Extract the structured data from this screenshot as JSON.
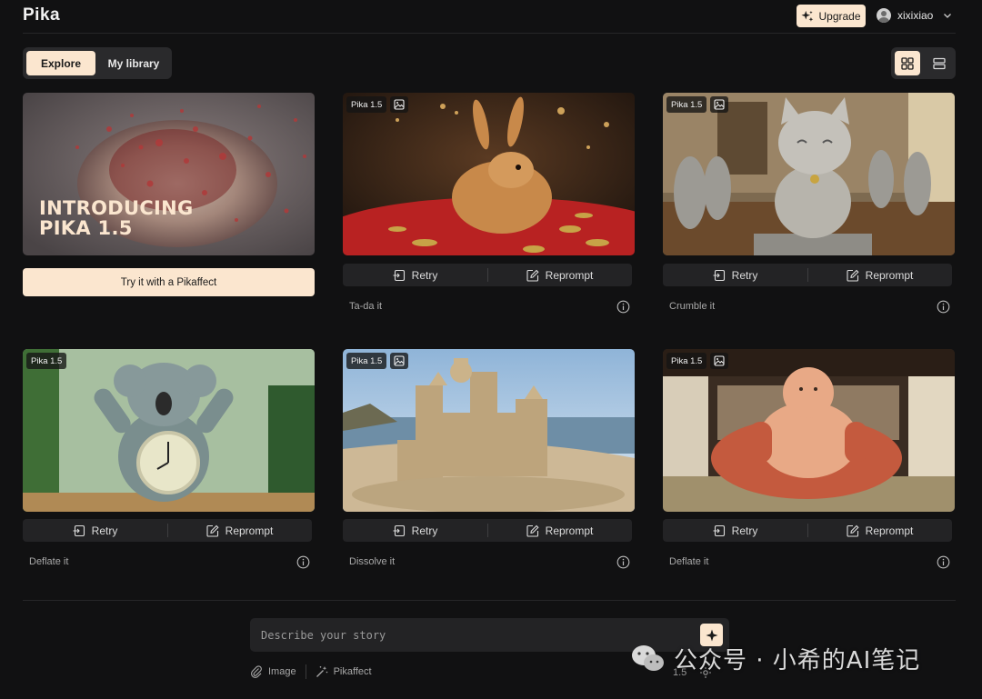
{
  "app": {
    "logo": "Pika"
  },
  "header": {
    "upgrade_label": "Upgrade",
    "username": "xixixiao"
  },
  "tabs": [
    {
      "label": "Explore",
      "active": true
    },
    {
      "label": "My library",
      "active": false
    }
  ],
  "promo": {
    "heading_line1": "INTRODUCING",
    "heading_line2": "PIKA 1.5",
    "button_label": "Try it with a Pikaffect"
  },
  "card_actions": {
    "retry_label": "Retry",
    "reprompt_label": "Reprompt"
  },
  "cards": [
    {
      "model": "Pika 1.5",
      "effect": "Ta-da it",
      "subject": "rabbit"
    },
    {
      "model": "Pika 1.5",
      "effect": "Crumble it",
      "subject": "cat-statue"
    },
    {
      "model": "Pika 1.5",
      "effect": "Deflate it",
      "subject": "koala-clock"
    },
    {
      "model": "Pika 1.5",
      "effect": "Dissolve it",
      "subject": "sandcastle"
    },
    {
      "model": "Pika 1.5",
      "effect": "Deflate it",
      "subject": "inflatable-figure"
    }
  ],
  "prompt": {
    "placeholder": "Describe your story"
  },
  "tools": {
    "image_label": "Image",
    "pikaffect_label": "Pikaffect",
    "version": "1.5"
  },
  "watermark": {
    "text": "公众号 · 小希的AI笔记"
  },
  "colors": {
    "accent": "#fbe6cf",
    "background": "#111112",
    "surface": "#232325"
  }
}
